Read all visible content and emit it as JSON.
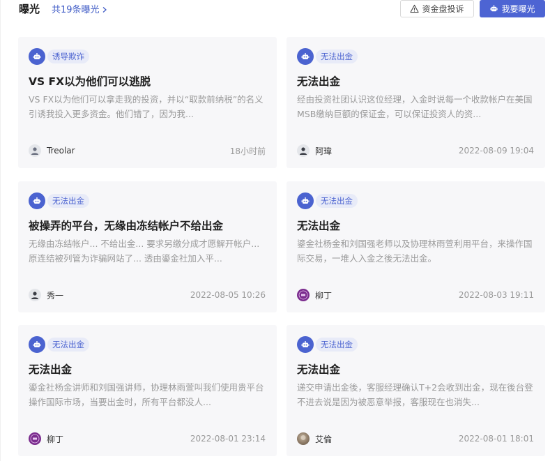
{
  "header": {
    "title": "曝光",
    "count_text": "共19条曝光",
    "complain_button": "资金盘投诉",
    "expose_button": "我要曝光"
  },
  "colors": {
    "accent": "#4d64d3",
    "tag_bg": "#e8ebf8",
    "card_bg": "#f7f7f9",
    "muted_text": "#9a9a9a"
  },
  "cards": [
    {
      "tag": "诱导欺诈",
      "title": "VS FX以为他们可以逃脱",
      "desc": "VS FX以为他们可以拿走我的投资，并以“取款前纳税”的名义引诱我投入更多资金。他们错了，因为我...",
      "author": "Treolar",
      "time": "18小时前",
      "avatar": "user-icon"
    },
    {
      "tag": "无法出金",
      "title": "无法出金",
      "desc": "经由投资社团认识这位经理，入金时说每一个收款帐户在美国MSB缴纳巨额的保证金，可以保证投资人的资...",
      "author": "阿瑋",
      "time": "2022-08-09 19:04",
      "avatar": "user-icon"
    },
    {
      "tag": "无法出金",
      "title": "被操弄的平台，无缘由冻结帐户不给出金",
      "desc": "无缘由冻结帐户... 不给出金... 要求另缴分成才愿解开帐户... 原连结被列管为诈骗网站了... 透由鎏金社加入平...",
      "author": "秀一",
      "time": "2022-08-05 10:26",
      "avatar": "user-icon"
    },
    {
      "tag": "无法出金",
      "title": "无法出金",
      "desc": "鎏金社杨金和刘国强老师以及协理林雨萱利用平台，来操作国际交易，一堆人入金之後无法出金。",
      "author": "柳丁",
      "time": "2022-08-03 19:11",
      "avatar": "purple"
    },
    {
      "tag": "无法出金",
      "title": "无法出金",
      "desc": "鎏金社杨金讲师和刘国强讲师，协理林雨萱叫我们使用贵平台操作国际市场，当要出金时，所有平台都没人...",
      "author": "柳丁",
      "time": "2022-08-01 23:14",
      "avatar": "purple"
    },
    {
      "tag": "无法出金",
      "title": "无法出金",
      "desc": "递交申请出金後，客服经理确认T+2会收到出金，现在後台登不进去说是因为被恶意举报，客服现在也消失...",
      "author": "艾倫",
      "time": "2022-08-01 18:01",
      "avatar": "photo"
    }
  ]
}
